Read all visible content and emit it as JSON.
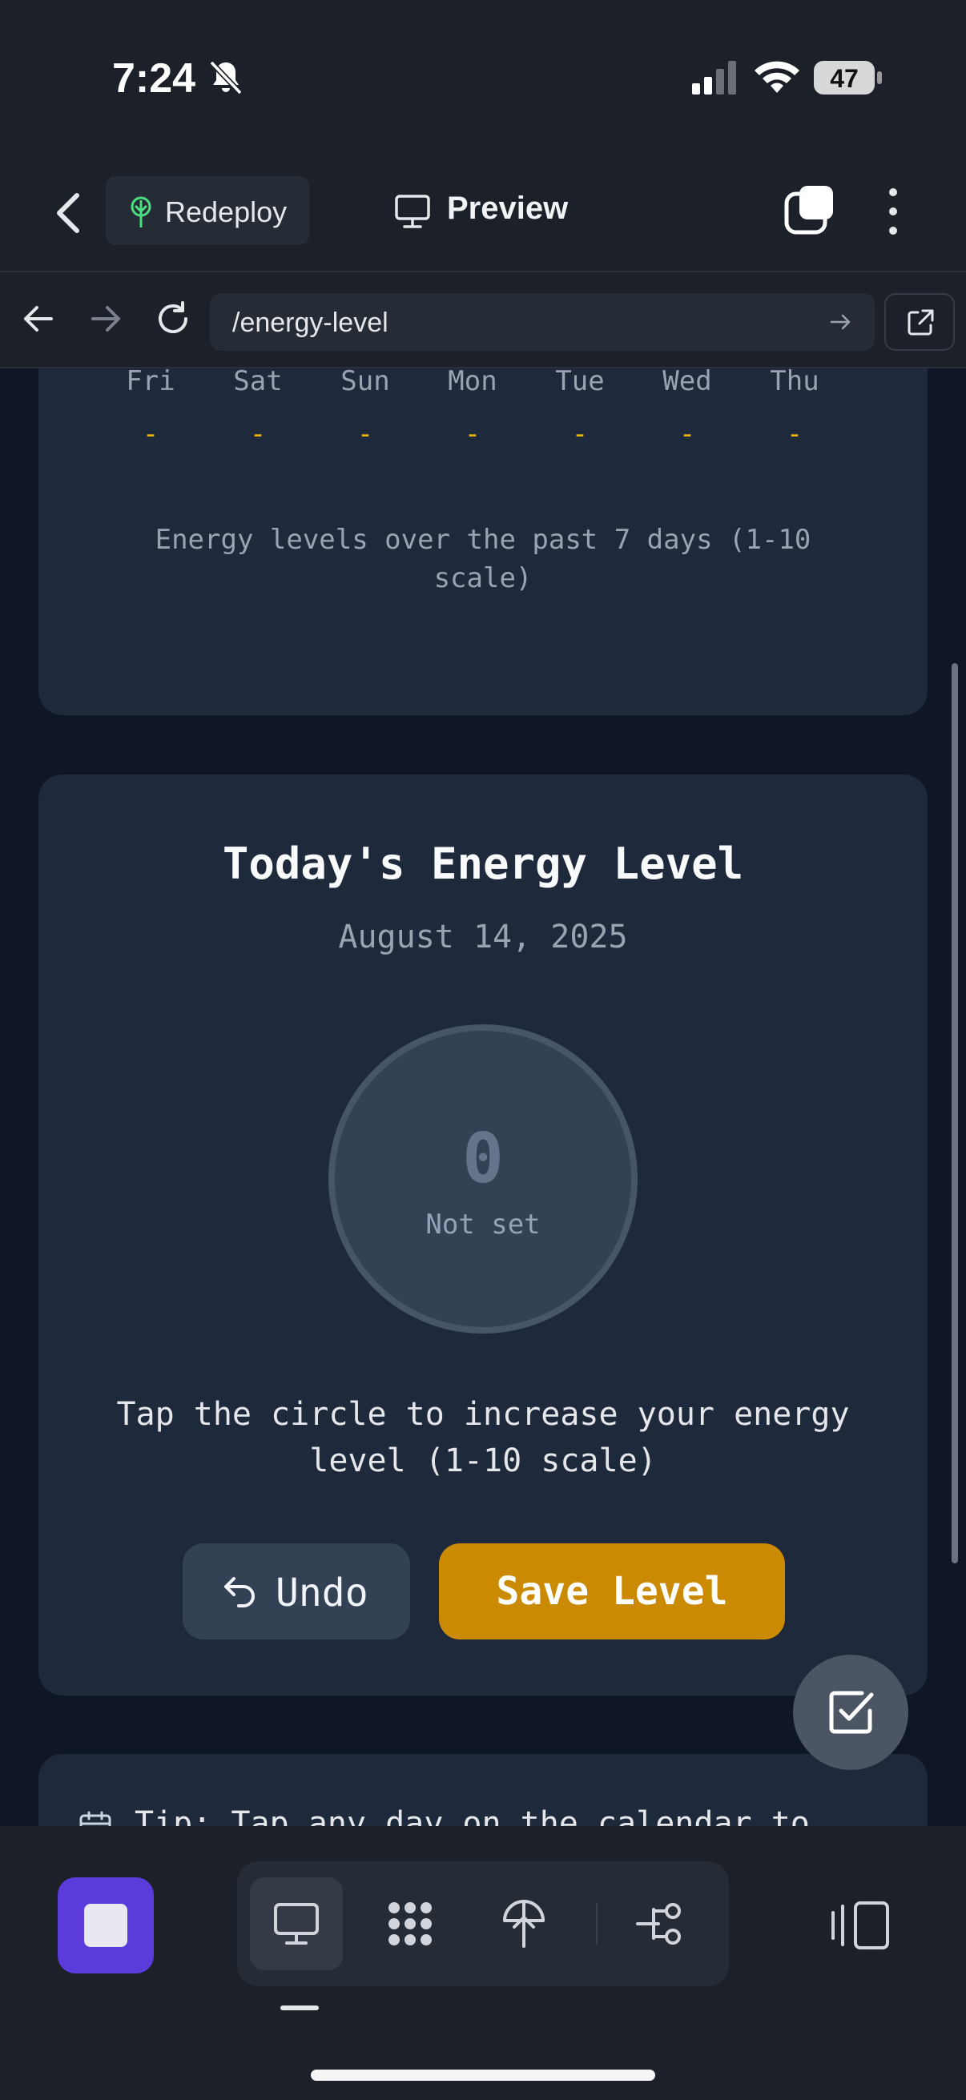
{
  "status_bar": {
    "time": "7:24",
    "battery": "47"
  },
  "header": {
    "redeploy_label": "Redeploy",
    "preview_label": "Preview"
  },
  "browser": {
    "url": "/energy-level"
  },
  "weekly": {
    "days": [
      {
        "name": "Fri",
        "value": "-"
      },
      {
        "name": "Sat",
        "value": "-"
      },
      {
        "name": "Sun",
        "value": "-"
      },
      {
        "name": "Mon",
        "value": "-"
      },
      {
        "name": "Tue",
        "value": "-"
      },
      {
        "name": "Wed",
        "value": "-"
      },
      {
        "name": "Thu",
        "value": "-"
      }
    ],
    "caption": "Energy levels over the past 7 days (1-10 scale)"
  },
  "today": {
    "title": "Today's Energy Level",
    "date": "August 14, 2025",
    "level": "0",
    "level_status": "Not set",
    "hint": "Tap the circle to increase your energy level (1-10 scale)",
    "undo_label": "Undo",
    "save_label": "Save Level"
  },
  "tip": {
    "text": "Tip: Tap any day on the calendar to"
  },
  "colors": {
    "accent_yellow": "#ca8a04",
    "stop_purple": "#5b3bdb",
    "card_bg": "#1e293b",
    "page_bg": "#0f1626"
  },
  "icons": {
    "status": [
      "bell-slash-icon",
      "cellular-signal-icon",
      "wifi-icon",
      "battery-icon"
    ],
    "header": [
      "chevron-left-icon",
      "deploy-tree-icon",
      "monitor-icon",
      "tabs-icon",
      "more-vertical-icon"
    ],
    "browser": [
      "arrow-left-icon",
      "arrow-right-icon",
      "reload-icon",
      "go-arrow-icon",
      "external-link-icon"
    ],
    "toolbar": [
      "stop-icon",
      "monitor-icon",
      "grid-dots-icon",
      "deploy-icon",
      "branch-icon",
      "panel-icon"
    ]
  }
}
